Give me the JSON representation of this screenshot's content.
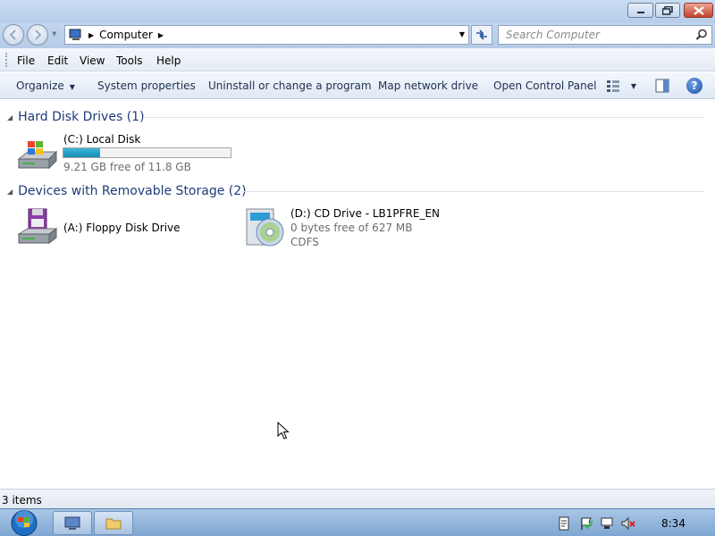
{
  "address": {
    "crumbs": [
      "Computer"
    ],
    "search_placeholder": "Search Computer"
  },
  "menu": {
    "items": [
      "File",
      "Edit",
      "View",
      "Tools",
      "Help"
    ]
  },
  "toolbar": {
    "organize": "Organize",
    "system_properties": "System properties",
    "uninstall": "Uninstall or change a program",
    "map_drive": "Map network drive",
    "control_panel": "Open Control Panel"
  },
  "groups": [
    {
      "title": "Hard Disk Drives (1)",
      "items": [
        {
          "name": "(C:) Local Disk",
          "free_text": "9.21 GB free of 11.8 GB",
          "used_fraction": 0.22,
          "icon": "hard-drive-icon"
        }
      ]
    },
    {
      "title": "Devices with Removable Storage (2)",
      "items": [
        {
          "name": "(A:) Floppy Disk Drive",
          "icon": "floppy-drive-icon"
        },
        {
          "name": "(D:) CD Drive - LB1PFRE_EN",
          "free_text": "0 bytes free of 627 MB",
          "filesystem": "CDFS",
          "icon": "cd-drive-icon"
        }
      ]
    }
  ],
  "status": {
    "items_count": "3 items"
  },
  "taskbar": {
    "clock": "8:34"
  },
  "colors": {
    "group_title": "#1e3b7a",
    "usage_bar": "#1a8cb4",
    "taskbar": "#7ea6d3"
  }
}
